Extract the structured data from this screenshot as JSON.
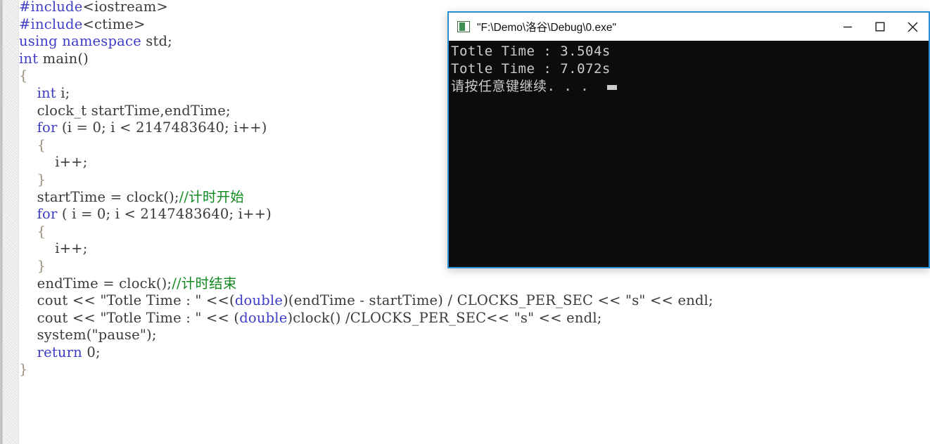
{
  "editor": {
    "name": "cpp-source-editor",
    "language": "C++",
    "colors": {
      "background": "#ffffff",
      "keyword": "#3c3cc8",
      "comment": "#108a20",
      "text": "#3a3a3a",
      "gutter": "#f3f3f3"
    },
    "code_lines": [
      [
        {
          "t": "#include",
          "c": "pre"
        },
        {
          "t": "<iostream>",
          "c": "id"
        }
      ],
      [
        {
          "t": "#include",
          "c": "pre"
        },
        {
          "t": "<ctime>",
          "c": "id"
        }
      ],
      [
        {
          "t": "using namespace",
          "c": "kw"
        },
        {
          "t": " std;",
          "c": "id"
        }
      ],
      [
        {
          "t": "int",
          "c": "kw"
        },
        {
          "t": " main()",
          "c": "id"
        }
      ],
      [
        {
          "t": "{",
          "c": "brc"
        }
      ],
      [
        {
          "t": "    ",
          "c": "id"
        },
        {
          "t": "int",
          "c": "kw"
        },
        {
          "t": " i;",
          "c": "id"
        }
      ],
      [
        {
          "t": "    clock_t startTime,endTime;",
          "c": "id"
        }
      ],
      [
        {
          "t": "    ",
          "c": "id"
        },
        {
          "t": "for",
          "c": "kw"
        },
        {
          "t": " (i = 0; i < 2147483640; i++)",
          "c": "id"
        }
      ],
      [
        {
          "t": "    {",
          "c": "brc"
        }
      ],
      [
        {
          "t": "        i++;",
          "c": "id"
        }
      ],
      [
        {
          "t": "    }",
          "c": "brc"
        }
      ],
      [
        {
          "t": "    startTime = clock();",
          "c": "id"
        },
        {
          "t": "//计时开始",
          "c": "cmt"
        }
      ],
      [
        {
          "t": "    ",
          "c": "id"
        },
        {
          "t": "for",
          "c": "kw"
        },
        {
          "t": " ( i = 0; i < 2147483640; i++)",
          "c": "id"
        }
      ],
      [
        {
          "t": "    {",
          "c": "brc"
        }
      ],
      [
        {
          "t": "        i++;",
          "c": "id"
        }
      ],
      [
        {
          "t": "    }",
          "c": "brc"
        }
      ],
      [
        {
          "t": "    endTime = clock();",
          "c": "id"
        },
        {
          "t": "//计时结束",
          "c": "cmt"
        }
      ],
      [
        {
          "t": "    cout << \"Totle Time : \" <<(",
          "c": "id"
        },
        {
          "t": "double",
          "c": "kw"
        },
        {
          "t": ")(endTime - startTime) / CLOCKS_PER_SEC << \"s\" << endl;",
          "c": "id"
        }
      ],
      [
        {
          "t": "    cout << \"Totle Time : \" << (",
          "c": "id"
        },
        {
          "t": "double",
          "c": "kw"
        },
        {
          "t": ")clock() /CLOCKS_PER_SEC<< \"s\" << endl;",
          "c": "id"
        }
      ],
      [
        {
          "t": "    system(\"pause\");",
          "c": "id"
        }
      ],
      [
        {
          "t": "    ",
          "c": "id"
        },
        {
          "t": "return",
          "c": "kw"
        },
        {
          "t": " 0;",
          "c": "id"
        }
      ],
      [
        {
          "t": "}",
          "c": "brc"
        }
      ]
    ]
  },
  "console_window": {
    "title": "\"F:\\Demo\\洛谷\\Debug\\0.exe\"",
    "icon": "console-app-icon",
    "border_color": "#2a8fd4",
    "background_color": "#0c0c0c",
    "text_color": "#cccccc",
    "buttons": {
      "minimize_label": "Minimize",
      "maximize_label": "Maximize",
      "close_label": "Close"
    },
    "output_lines": [
      "Totle Time : 3.504s",
      "Totle Time : 7.072s",
      "请按任意键继续. . ."
    ],
    "caret_visible": true
  }
}
